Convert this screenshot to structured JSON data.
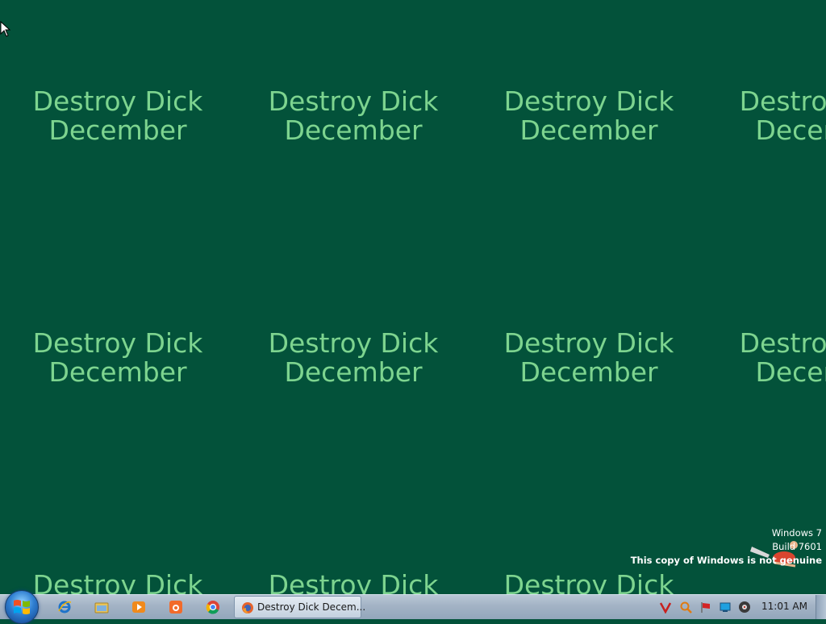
{
  "wallpaper": {
    "line1": "Destroy Dick",
    "line2": "December",
    "text_color": "#7dd48f",
    "background_color": "#03523a"
  },
  "watermark": {
    "line1": "Windows 7",
    "line2": "Build 7601",
    "line3": "This copy of Windows is not genuine"
  },
  "taskbar": {
    "pinned": [
      "internet-explorer-icon",
      "windows-explorer-icon",
      "media-player-icon",
      "uc-browser-icon",
      "chrome-icon"
    ],
    "active_task_label": "Destroy Dick Decem...",
    "clock": "11:01 AM"
  }
}
